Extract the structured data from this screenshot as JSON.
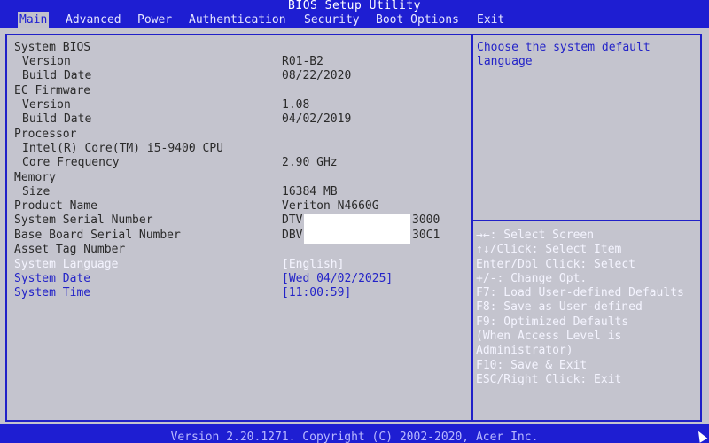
{
  "window": {
    "title": "BIOS Setup Utility",
    "footer": "Version 2.20.1271. Copyright (C) 2002-2020, Acer Inc."
  },
  "tabs": [
    {
      "label": "Main"
    },
    {
      "label": "Advanced"
    },
    {
      "label": "Power"
    },
    {
      "label": "Authentication"
    },
    {
      "label": "Security"
    },
    {
      "label": "Boot Options"
    },
    {
      "label": "Exit"
    }
  ],
  "main": {
    "system_bios": {
      "heading": "System BIOS",
      "version_label": "Version",
      "version": "R01-B2",
      "build_date_label": "Build Date",
      "build_date": "08/22/2020"
    },
    "ec_firmware": {
      "heading": "EC Firmware",
      "version_label": "Version",
      "version": "1.08",
      "build_date_label": "Build Date",
      "build_date": "04/02/2019"
    },
    "processor": {
      "heading": "Processor",
      "name": "Intel(R) Core(TM) i5-9400 CPU",
      "frequency_label": "Core Frequency",
      "frequency": "2.90 GHz"
    },
    "memory": {
      "heading": "Memory",
      "size_label": "Size",
      "size": "16384 MB"
    },
    "product": {
      "label": "Product Name",
      "value": "Veriton N4660G"
    },
    "serial": {
      "label": "System Serial Number",
      "prefix": "DTV",
      "suffix": "3000"
    },
    "board_serial": {
      "label": "Base Board Serial Number",
      "prefix": "DBV",
      "suffix": "30C1"
    },
    "asset_tag": {
      "label": "Asset Tag Number"
    },
    "language": {
      "label": "System Language",
      "value": "[English]"
    },
    "date": {
      "label": "System Date",
      "value": "[Wed 04/02/2025]"
    },
    "time": {
      "label": "System Time",
      "value": "[11:00:59]"
    }
  },
  "help": {
    "description": "Choose the system default language",
    "keys": [
      "→←: Select Screen",
      "↑↓/Click: Select Item",
      "Enter/Dbl Click: Select",
      "+/-: Change Opt.",
      "F7: Load User-defined Defaults",
      "F8: Save as User-defined",
      "F9: Optimized Defaults",
      "(When Access Level is",
      "Administrator)",
      "F10: Save & Exit",
      "ESC/Right Click: Exit"
    ]
  },
  "colors": {
    "bar": "#1e1ed2",
    "panel": "#c4c4ce",
    "editable": "#2323c8",
    "highlight": "#ffffff"
  }
}
